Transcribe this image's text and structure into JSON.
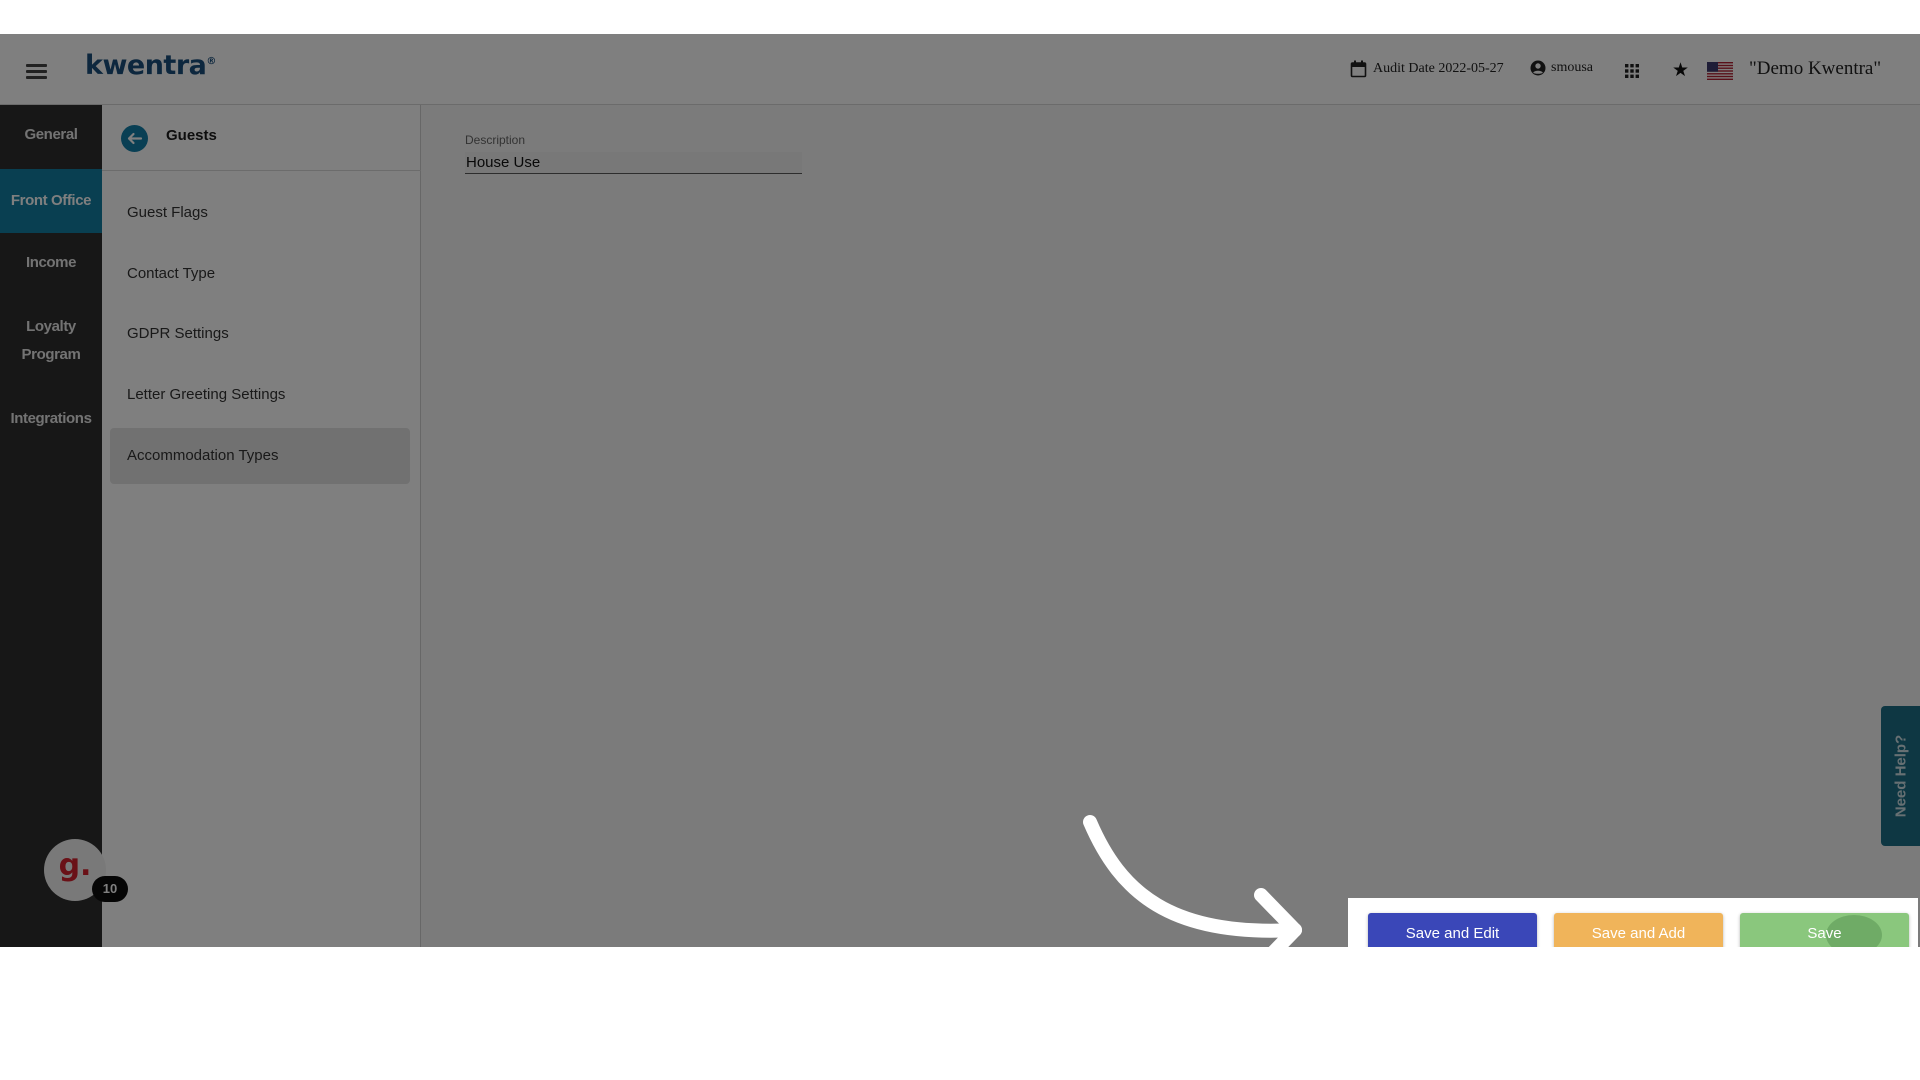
{
  "topbar": {
    "logo": "kwentra",
    "audit_date": "Audit Date 2022-05-27",
    "username": "smousa",
    "company": "\"Demo Kwentra\""
  },
  "modules": [
    {
      "label": "General"
    },
    {
      "label": "Front Office",
      "active": true
    },
    {
      "label": "Income"
    },
    {
      "label": "Loyalty Program"
    },
    {
      "label": "Integrations"
    }
  ],
  "subnav": {
    "title": "Guests",
    "items": [
      {
        "label": "Guest Flags"
      },
      {
        "label": "Contact Type"
      },
      {
        "label": "GDPR Settings"
      },
      {
        "label": "Letter Greeting Settings"
      },
      {
        "label": "Accommodation Types",
        "active": true
      }
    ]
  },
  "form": {
    "description_label": "Description",
    "description_value": "House Use"
  },
  "avatar": {
    "letter": "g.",
    "badge": "10"
  },
  "help": {
    "label": "Need Help?"
  },
  "actions": {
    "save_and_edit": "Save and Edit",
    "save_and_add": "Save and Add",
    "save": "Save"
  },
  "colors": {
    "module_nav_bg": "#2f2f2f",
    "module_active": "#137fa2",
    "logo": "#1b4f7c",
    "save_and_edit": "#3a47b8",
    "save_and_add": "#f0b45a",
    "save": "#8ac77d"
  },
  "icons": [
    "menu-icon",
    "calendar-icon",
    "user-circle-icon",
    "apps-grid-icon",
    "star-icon",
    "us-flag-icon",
    "back-arrow-icon",
    "curved-arrow-annotation"
  ]
}
